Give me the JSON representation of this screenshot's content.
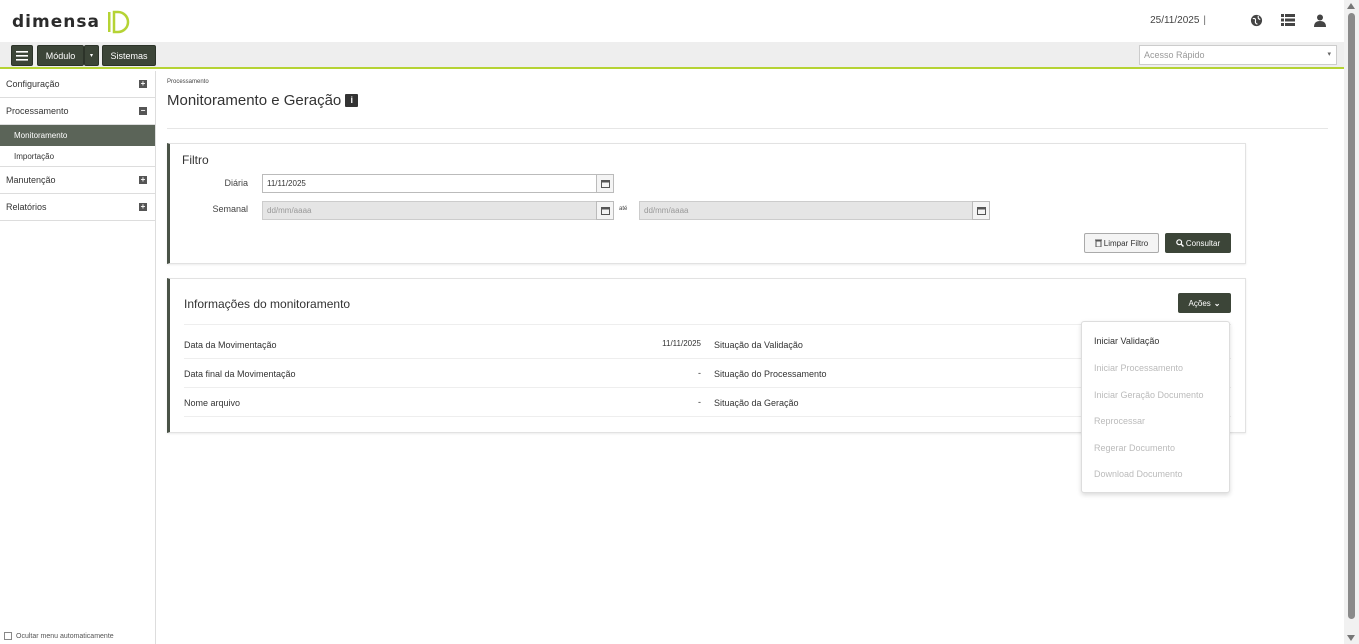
{
  "header": {
    "logo_text": "dimensa",
    "date": "25/11/2025",
    "separator": "|",
    "icons": [
      "globe-icon",
      "list-icon",
      "user-icon"
    ]
  },
  "navbar": {
    "modulo_label": "Módulo",
    "sistemas_label": "Sistemas",
    "quick_access_placeholder": "Acesso Rápido"
  },
  "sidebar": {
    "items": [
      {
        "label": "Configuração",
        "toggle": "+"
      },
      {
        "label": "Processamento",
        "toggle": "−"
      },
      {
        "label": "Manutenção",
        "toggle": "+"
      },
      {
        "label": "Relatórios",
        "toggle": "+"
      }
    ],
    "sub_items": [
      {
        "label": "Monitoramento",
        "active": true
      },
      {
        "label": "Importação",
        "active": false
      }
    ],
    "hide_menu_label": "Ocultar menu automaticamente"
  },
  "page": {
    "breadcrumb": "Processamento",
    "title": "Monitoramento e Geração"
  },
  "filter": {
    "title": "Filtro",
    "diaria_label": "Diária",
    "diaria_value": "11/11/2025",
    "semanal_label": "Semanal",
    "semanal_from_placeholder": "dd/mm/aaaa",
    "ate_label": "até",
    "semanal_to_placeholder": "dd/mm/aaaa",
    "clear_button": "Limpar Filtro",
    "search_button": "Consultar"
  },
  "monitor": {
    "title": "Informações do monitoramento",
    "actions_button": "Ações",
    "rows": [
      {
        "label": "Data da Movimentação",
        "value": "11/11/2025",
        "status_label": "Situação da Validação"
      },
      {
        "label": "Data final da Movimentação",
        "value": "-",
        "status_label": "Situação do Processamento"
      },
      {
        "label": "Nome arquivo",
        "value": "-",
        "status_label": "Situação da Geração"
      }
    ]
  },
  "actions_menu": {
    "items": [
      {
        "label": "Iniciar Validação",
        "enabled": true
      },
      {
        "label": "Iniciar Processamento",
        "enabled": false
      },
      {
        "label": "Iniciar Geração Documento",
        "enabled": false
      },
      {
        "label": "Reprocessar",
        "enabled": false
      },
      {
        "label": "Regerar Documento",
        "enabled": false
      },
      {
        "label": "Download Documento",
        "enabled": false
      }
    ]
  },
  "colors": {
    "brand_green": "#b5d334",
    "dark_button": "#3c4538",
    "active_menu": "#5b6458"
  }
}
